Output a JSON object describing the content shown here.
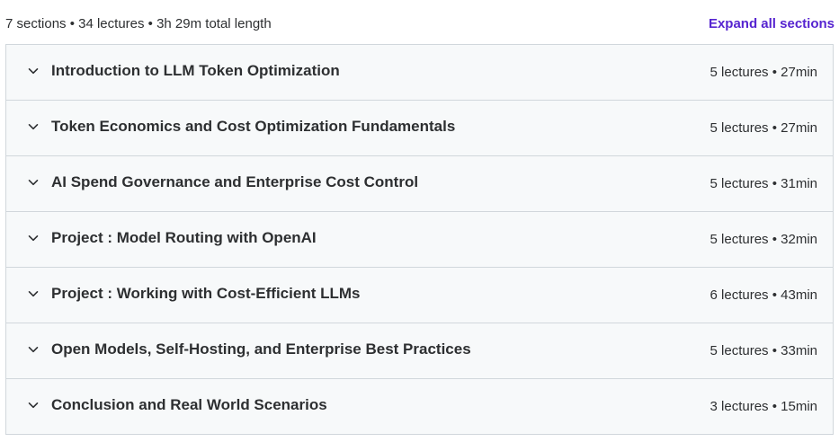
{
  "summary": {
    "text": "7 sections • 34 lectures • 3h 29m total length",
    "expand_label": "Expand all sections"
  },
  "colors": {
    "accent": "#5624d0",
    "section_background": "#f7f9fa",
    "border": "#d1d7dc",
    "text": "#2d2f31"
  },
  "icons": {
    "section_toggle": "chevron-down-icon"
  },
  "sections": [
    {
      "title": "Introduction to LLM Token Optimization",
      "meta": "5 lectures • 27min"
    },
    {
      "title": "Token Economics and Cost Optimization Fundamentals",
      "meta": "5 lectures • 27min"
    },
    {
      "title": "AI Spend Governance and Enterprise Cost Control",
      "meta": "5 lectures • 31min"
    },
    {
      "title": "Project : Model Routing with OpenAI",
      "meta": "5 lectures • 32min"
    },
    {
      "title": "Project : Working with Cost-Efficient LLMs",
      "meta": "6 lectures • 43min"
    },
    {
      "title": "Open Models, Self-Hosting, and Enterprise Best Practices",
      "meta": "5 lectures • 33min"
    },
    {
      "title": "Conclusion and Real World Scenarios",
      "meta": "3 lectures • 15min"
    }
  ]
}
